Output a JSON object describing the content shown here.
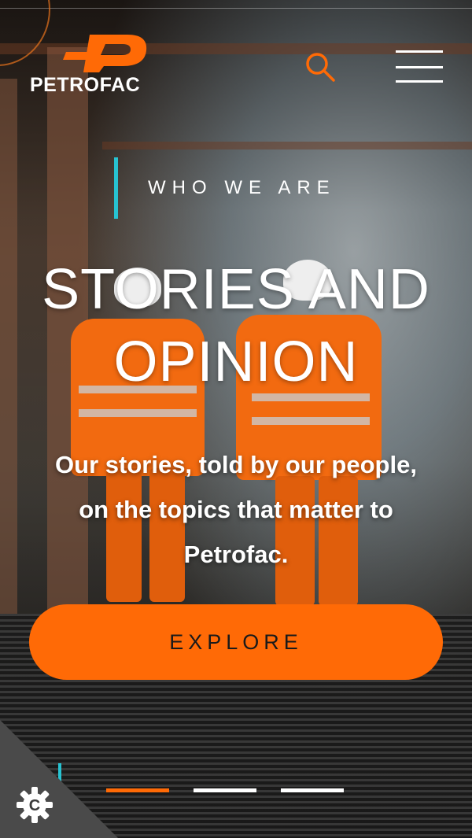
{
  "brand": {
    "name": "PETROFAC",
    "accent_color": "#ff6a06",
    "highlight_color": "#27c3d2"
  },
  "header": {
    "search_icon": "search-icon",
    "menu_icon": "hamburger-menu-icon"
  },
  "hero": {
    "eyebrow": "WHO WE ARE",
    "headline_line1": "STORIES AND",
    "headline_line2": "OPINION",
    "subtext_line1": "Our stories, told by our people,",
    "subtext_line2": "on the topics that matter to",
    "subtext_line3": "Petrofac.",
    "cta_label": "EXPLORE"
  },
  "pager": {
    "slides": 3,
    "active_index": 0,
    "active_color": "#ff6a06",
    "inactive_color": "#ffffff"
  },
  "cookie": {
    "icon": "cookie-settings-icon",
    "letter": "C"
  }
}
